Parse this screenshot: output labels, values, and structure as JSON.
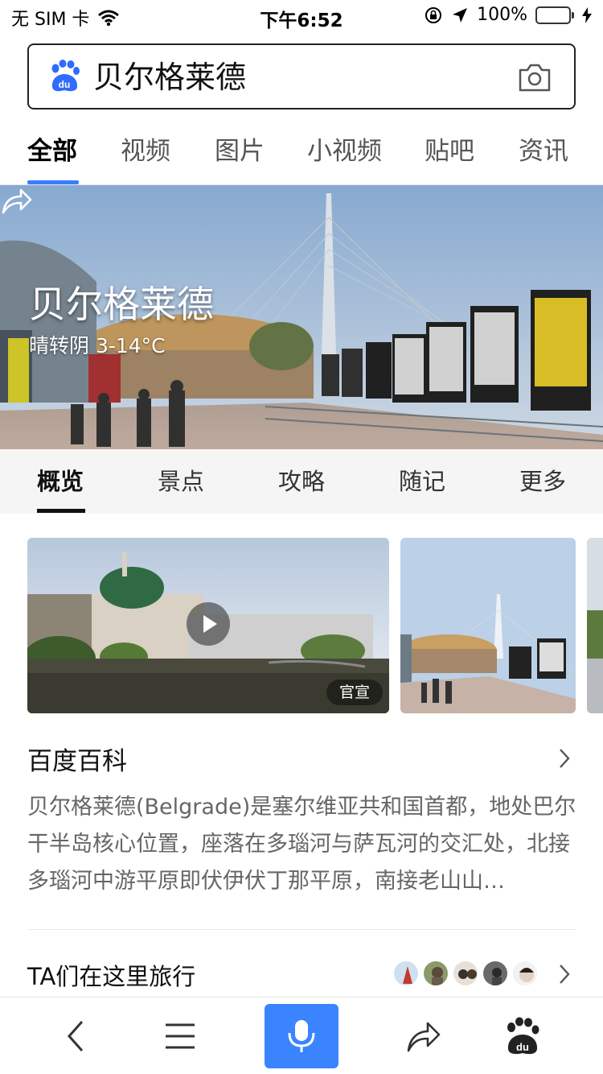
{
  "status_bar": {
    "carrier": "无 SIM 卡",
    "time": "下午6:52",
    "battery": "100%",
    "battery_level": 1.0,
    "wifi_icon": "wifi-icon",
    "orientation_lock_icon": "orientation-lock-icon",
    "location_icon": "location-arrow-icon",
    "charging_icon": "charging-bolt-icon"
  },
  "search": {
    "query": "贝尔格莱德",
    "logo_icon": "baidu-paw-icon",
    "camera_icon": "camera-icon"
  },
  "tabs": [
    {
      "label": "全部",
      "active": true
    },
    {
      "label": "视频"
    },
    {
      "label": "图片"
    },
    {
      "label": "小视频"
    },
    {
      "label": "贴吧"
    },
    {
      "label": "资讯"
    }
  ],
  "hero": {
    "title": "贝尔格莱德",
    "weather": "晴转阴 3-14°C",
    "share_icon": "share-icon"
  },
  "sub_tabs": [
    {
      "label": "概览",
      "active": true
    },
    {
      "label": "景点"
    },
    {
      "label": "攻略"
    },
    {
      "label": "随记"
    },
    {
      "label": "更多"
    }
  ],
  "media": {
    "badge": "官宣",
    "play_icon": "play-icon"
  },
  "baike": {
    "title": "百度百科",
    "description": "贝尔格莱德(Belgrade)是塞尔维亚共和国首都，地处巴尔干半岛核心位置，座落在多瑙河与萨瓦河的交汇处，北接多瑙河中游平原即伏伊伏丁那平原，南接老山山…"
  },
  "travel": {
    "title": "TA们在这里旅行"
  },
  "bottom_bar": {
    "back_icon": "back-chevron-icon",
    "menu_icon": "hamburger-menu-icon",
    "voice_icon": "microphone-icon",
    "share_icon": "share-icon",
    "home_icon": "baidu-paw-icon"
  },
  "colors": {
    "accent": "#3a85ff",
    "battery_green": "#4cd964"
  }
}
